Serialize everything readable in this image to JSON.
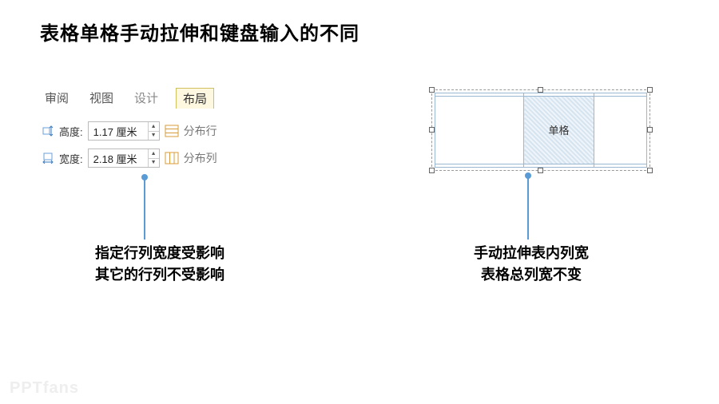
{
  "title": "表格单格手动拉伸和键盘输入的不同",
  "tabs": {
    "review": "审阅",
    "view": "视图",
    "design": "设计",
    "layout": "布局"
  },
  "controls": {
    "height_label": "高度:",
    "height_value": "1.17 厘米",
    "dist_rows": "分布行",
    "width_label": "宽度:",
    "width_value": "2.18 厘米",
    "dist_cols": "分布列"
  },
  "captions": {
    "left_line1": "指定行列宽度受影响",
    "left_line2": "其它的行列不受影响",
    "right_line1": "手动拉伸表内列宽",
    "right_line2": "表格总列宽不变"
  },
  "table": {
    "cell_label": "单格"
  },
  "watermark": "PPTfans"
}
